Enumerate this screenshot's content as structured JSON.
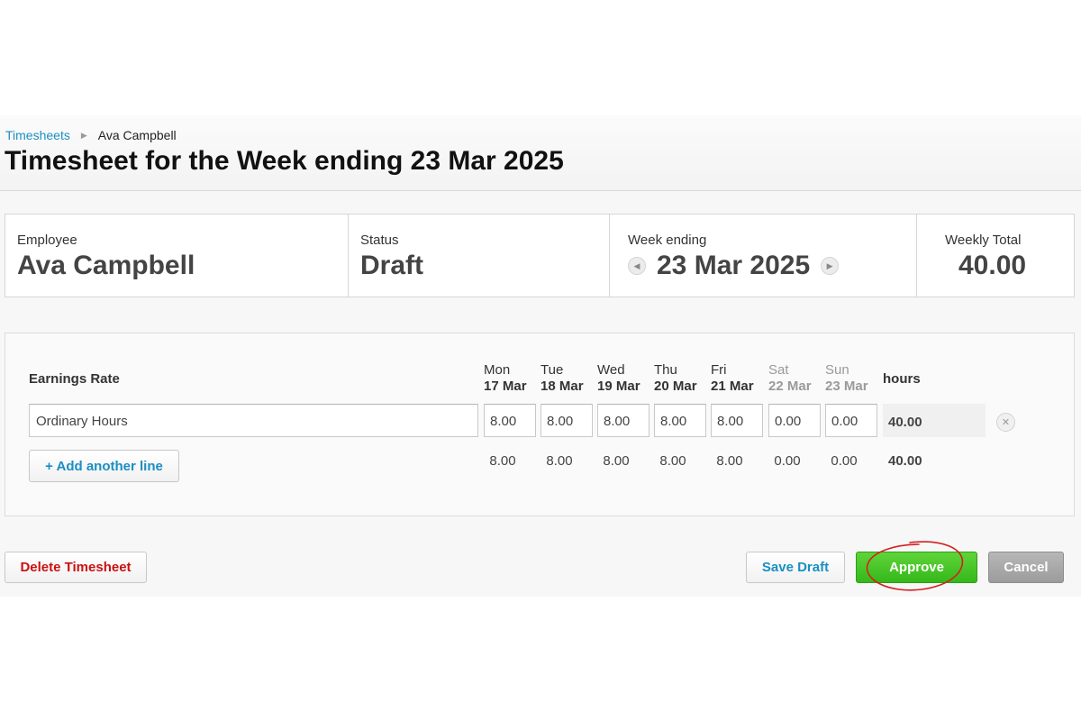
{
  "breadcrumb": {
    "parent": "Timesheets",
    "current": "Ava Campbell"
  },
  "page_title": "Timesheet for the Week ending 23 Mar 2025",
  "summary": {
    "employee_label": "Employee",
    "employee_value": "Ava Campbell",
    "status_label": "Status",
    "status_value": "Draft",
    "week_label": "Week ending",
    "week_value": "23 Mar 2025",
    "total_label": "Weekly Total",
    "total_value": "40.00"
  },
  "grid": {
    "earnings_header": "Earnings Rate",
    "hours_header": "hours",
    "days": [
      {
        "name": "Mon",
        "date": "17 Mar"
      },
      {
        "name": "Tue",
        "date": "18 Mar"
      },
      {
        "name": "Wed",
        "date": "19 Mar"
      },
      {
        "name": "Thu",
        "date": "20 Mar"
      },
      {
        "name": "Fri",
        "date": "21 Mar"
      },
      {
        "name": "Sat",
        "date": "22 Mar"
      },
      {
        "name": "Sun",
        "date": "23 Mar"
      }
    ],
    "row": {
      "earnings_rate": "Ordinary Hours",
      "values": [
        "8.00",
        "8.00",
        "8.00",
        "8.00",
        "8.00",
        "0.00",
        "0.00"
      ],
      "total": "40.00"
    },
    "totals": [
      "8.00",
      "8.00",
      "8.00",
      "8.00",
      "8.00",
      "0.00",
      "0.00"
    ],
    "grand_total": "40.00",
    "add_line_label": "+ Add another line"
  },
  "actions": {
    "delete": "Delete Timesheet",
    "save": "Save Draft",
    "approve": "Approve",
    "cancel": "Cancel"
  },
  "colors": {
    "link": "#1a8fc3",
    "approve": "#3cc21f",
    "danger": "#cc1111",
    "annotation": "#d42020"
  },
  "icons": {
    "breadcrumb_separator": "chevron-right-icon",
    "prev": "chevron-left-icon",
    "next": "chevron-right-icon",
    "remove": "close-icon"
  }
}
